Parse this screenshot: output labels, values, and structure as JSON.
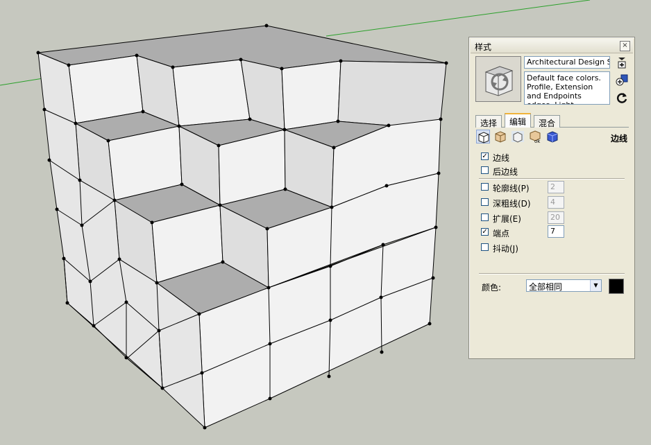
{
  "panel": {
    "title": "样式",
    "close_label": "×",
    "style_name": "Architectural Design Style",
    "style_description": "Default face colors. Profile, Extension and Endpoints edges. Light",
    "tabs": [
      {
        "label": "选择"
      },
      {
        "label": "编辑"
      },
      {
        "label": "混合"
      }
    ],
    "active_tab": "编辑",
    "section_title": "边线",
    "options": [
      {
        "label": "边线",
        "checked": true,
        "check_glyph": "✓"
      },
      {
        "label": "后边线",
        "checked": false,
        "check_glyph": ""
      },
      {
        "label": "轮廓线(P)",
        "checked": false,
        "check_glyph": "",
        "value": "2"
      },
      {
        "label": "深粗线(D)",
        "checked": false,
        "check_glyph": "",
        "value": "4"
      },
      {
        "label": "扩展(E)",
        "checked": false,
        "check_glyph": "",
        "value": "20"
      },
      {
        "label": "端点",
        "checked": true,
        "check_glyph": "✓",
        "value": "7"
      },
      {
        "label": "抖动(J)",
        "checked": false,
        "check_glyph": ""
      }
    ],
    "color": {
      "label": "颜色:",
      "selected": "全部相同",
      "swatch": "#000000"
    }
  },
  "colors": {
    "background": "#c6c8bf",
    "face_light": "#f2f2f2",
    "face_side": "#dedede",
    "face_top": "#adadad",
    "edge": "#000000",
    "axis_green": "#2aa02a"
  },
  "icons": [
    "style-thumbnail-icon",
    "create-style-icon",
    "add-style-icon",
    "update-style-icon",
    "edge-settings-icon",
    "face-settings-icon",
    "background-settings-icon",
    "watermark-settings-icon",
    "modeling-settings-icon"
  ]
}
